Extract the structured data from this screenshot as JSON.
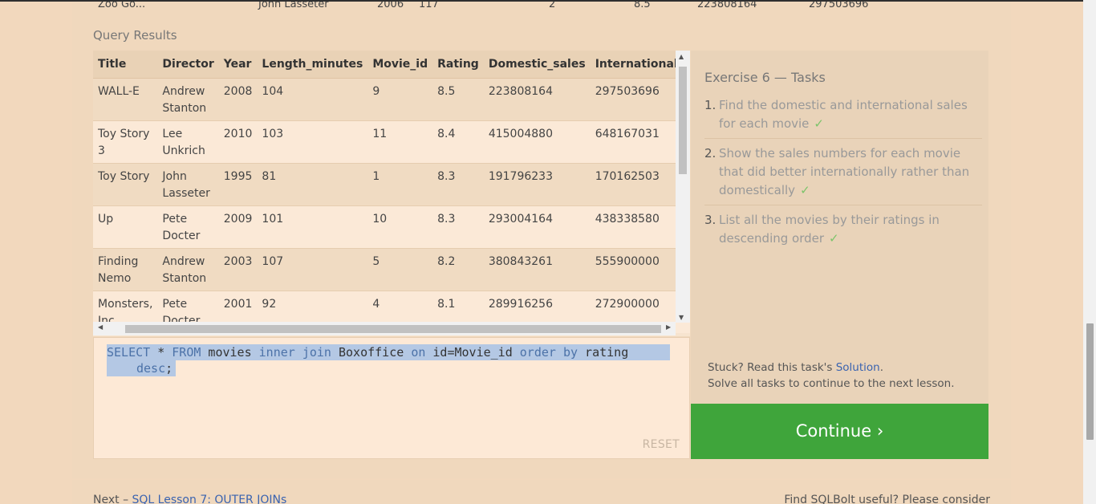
{
  "previous_row_cut": [
    "Zoo Go...",
    "John Lasseter",
    "2006",
    "117",
    "2",
    "8.5",
    "223808164",
    "297503696"
  ],
  "query_results_label": "Query Results",
  "table": {
    "columns": [
      "Title",
      "Director",
      "Year",
      "Length_minutes",
      "Movie_id",
      "Rating",
      "Domestic_sales",
      "International_sales"
    ],
    "rows": [
      {
        "title": "WALL-E",
        "director": "Andrew Stanton",
        "year": "2008",
        "length": "104",
        "movie_id": "9",
        "rating": "8.5",
        "domestic": "223808164",
        "international": "297503696"
      },
      {
        "title": "Toy Story 3",
        "director": "Lee Unkrich",
        "year": "2010",
        "length": "103",
        "movie_id": "11",
        "rating": "8.4",
        "domestic": "415004880",
        "international": "648167031"
      },
      {
        "title": "Toy Story",
        "director": "John Lasseter",
        "year": "1995",
        "length": "81",
        "movie_id": "1",
        "rating": "8.3",
        "domestic": "191796233",
        "international": "170162503"
      },
      {
        "title": "Up",
        "director": "Pete Docter",
        "year": "2009",
        "length": "101",
        "movie_id": "10",
        "rating": "8.3",
        "domestic": "293004164",
        "international": "438338580"
      },
      {
        "title": "Finding Nemo",
        "director": "Andrew Stanton",
        "year": "2003",
        "length": "107",
        "movie_id": "5",
        "rating": "8.2",
        "domestic": "380843261",
        "international": "555900000"
      },
      {
        "title": "Monsters, Inc.",
        "director": "Pete Docter",
        "year": "2001",
        "length": "92",
        "movie_id": "4",
        "rating": "8.1",
        "domestic": "289916256",
        "international": "272900000"
      }
    ]
  },
  "editor": {
    "kw1": "SELECT",
    "t1": " * ",
    "kw2": "FROM",
    "t2": " movies ",
    "kw3": "inner join",
    "t3": " Boxoffice ",
    "kw4": "on",
    "t4": " id=Movie_id ",
    "kw5": "order by",
    "t5": " rating",
    "kw6": "desc",
    "t6": ";",
    "reset_label": "RESET"
  },
  "tasks": {
    "title": "Exercise 6 — Tasks",
    "items": [
      {
        "num": "1.",
        "text": "Find the domestic and international sales for each movie",
        "check": "✓"
      },
      {
        "num": "2.",
        "text": "Show the sales numbers for each movie that did better internationally rather than domestically",
        "check": "✓"
      },
      {
        "num": "3.",
        "text": "List all the movies by their ratings in descending order",
        "check": "✓"
      }
    ],
    "stuck_prefix": "Stuck? Read this task's ",
    "solution_link": "Solution",
    "stuck_suffix": ".",
    "solve_all": "Solve all tasks to continue to the next lesson."
  },
  "continue_label": "Continue ›",
  "footer": {
    "next_prefix": "Next – ",
    "next_link": "SQL Lesson 7: OUTER JOINs",
    "useful": "Find SQLBolt useful? Please consider"
  },
  "colors": {
    "background": "#f2d8bd",
    "continue": "#3fa53b",
    "link": "#3a63b0",
    "keyword": "#4c72a8",
    "selection": "#b4c8e4",
    "check": "#7cc46a"
  }
}
